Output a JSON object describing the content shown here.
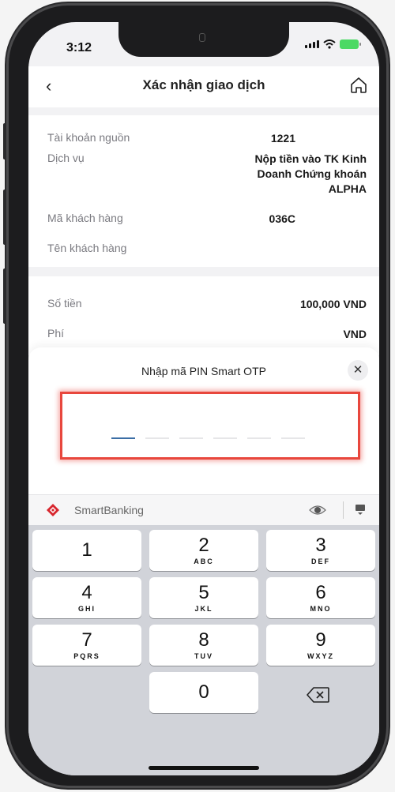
{
  "status_bar": {
    "time": "3:12"
  },
  "nav": {
    "back_icon": "‹",
    "title": "Xác nhận giao dịch"
  },
  "details": {
    "source_account_label": "Tài khoản nguồn",
    "source_account_value": "1221",
    "service_label": "Dịch vụ",
    "service_value_lines": [
      "Nộp tiền vào TK Kinh",
      "Doanh Chứng khoán",
      "ALPHA"
    ],
    "customer_code_label": "Mã khách hàng",
    "customer_code_value": "036C",
    "customer_name_label": "Tên khách hàng"
  },
  "amounts": {
    "amount_label": "Số tiền",
    "amount_value": "100,000 VND",
    "fee_label": "Phí",
    "fee_value": "VND"
  },
  "pin_sheet": {
    "title": "Nhập mã PIN Smart OTP",
    "close_icon": "✕",
    "pin_length": 6,
    "active_index": 0
  },
  "keyboard": {
    "brand": "SmartBanking",
    "keys": [
      {
        "num": "1",
        "letters": ""
      },
      {
        "num": "2",
        "letters": "ABC"
      },
      {
        "num": "3",
        "letters": "DEF"
      },
      {
        "num": "4",
        "letters": "GHI"
      },
      {
        "num": "5",
        "letters": "JKL"
      },
      {
        "num": "6",
        "letters": "MNO"
      },
      {
        "num": "7",
        "letters": "PQRS"
      },
      {
        "num": "8",
        "letters": "TUV"
      },
      {
        "num": "9",
        "letters": "WXYZ"
      },
      {
        "num": "0",
        "letters": ""
      }
    ]
  },
  "colors": {
    "accent_red": "#e8473d",
    "active_dash": "#3b6ea5",
    "brand_red": "#d7262e"
  }
}
